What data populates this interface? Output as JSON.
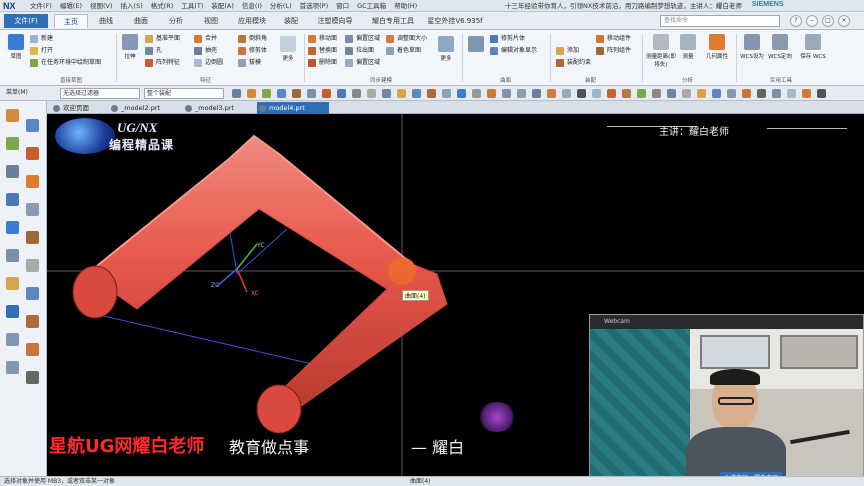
{
  "app": {
    "logo": "NX",
    "menus": [
      "文件(F)",
      "编辑(E)",
      "视图(V)",
      "插入(S)",
      "格式(R)",
      "工具(T)",
      "装配(A)",
      "信息(I)",
      "分析(L)",
      "首选项(P)",
      "窗口",
      "GC工具箱",
      "帮助(H)"
    ],
    "marquee": "十三年经验带你育人，引领NX技术前沿，用刀路编制梦想轨迹，主讲人：耀白老师",
    "brand": "SIEMENS"
  },
  "tabs": {
    "file": "文件(F)",
    "items": [
      "主页",
      "曲线",
      "曲面",
      "分析",
      "视图",
      "应用模块",
      "装配",
      "注塑模向导",
      "耀白专用工具",
      "星空外挂V6.935f"
    ],
    "active": "主页",
    "search_placeholder": "查找命令"
  },
  "ribbon": {
    "sketch_big": "草图",
    "sketch_items": [
      "新建",
      "打开",
      "在任务环境中绘制草图"
    ],
    "extrude_big": "拉伸",
    "feature_col1": [
      "基准平面",
      "孔",
      "阵列特征"
    ],
    "feature_col2": [
      "合并",
      "抽壳",
      "边倒圆"
    ],
    "feature_col3": [
      "倒斜角",
      "修剪体",
      "拔模"
    ],
    "more1": "更多",
    "sync_col1": [
      "移动面",
      "替换面",
      "删除面"
    ],
    "sync_col2": [
      "偏置区域",
      "拉出面",
      "偏置区域"
    ],
    "sync_col3": [
      "调整面大小",
      "着色草图",
      ""
    ],
    "more2": "更多",
    "surf_col": [
      "修剪片体",
      "编辑对象显示",
      ""
    ],
    "asm_col1": [
      "",
      "添加",
      "装配约束"
    ],
    "asm_col2": [
      "移动组件",
      "阵列组件",
      ""
    ],
    "analysis": [
      "测量距离(即将失)",
      "测量",
      "几何属性"
    ],
    "wcs": [
      "WCS设为",
      "WCS定向",
      "保存 WCS"
    ],
    "groups": [
      "直接草图",
      "特征",
      "同步建模",
      "曲面",
      "装配",
      "分析",
      "实用工具"
    ]
  },
  "toolbar2": {
    "menu_label": "菜单(M)",
    "filter": "无选择过滤器",
    "assembly": "整个装配"
  },
  "doc_tabs": [
    "欢迎页面",
    "_model2.prt",
    "_model3.prt",
    "model4.prt"
  ],
  "doc_tab_active": "model4.prt",
  "viewport": {
    "logo_en": "UG/NX",
    "logo_cn": "编程精品课",
    "presenter": "主讲：耀白老师",
    "tooltip": "曲面(4)",
    "axis_labels": [
      "YC",
      "XC",
      "ZC"
    ],
    "caption_left": "星航UG网耀白老师",
    "caption_mid": "教育做点事",
    "caption_right": "— 耀白",
    "pipe_color": "#e8574c"
  },
  "webcam": {
    "title": "Webcam",
    "badge": "主讲老师：耀白老师"
  },
  "status": {
    "left": "选择对象并使用 MB3，或者双击某一对象",
    "mid": "曲面(4)"
  }
}
